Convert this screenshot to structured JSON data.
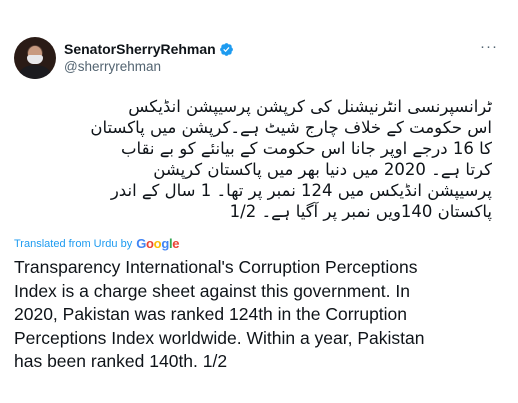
{
  "user": {
    "display_name": "SenatorSherryRehman",
    "handle": "@sherryrehman"
  },
  "icons": {
    "verified": "verified-badge-icon",
    "more": "more-options-icon",
    "avatar": "profile-avatar"
  },
  "colors": {
    "verified": "#1d9bf0",
    "translation_link": "#1d9bf0",
    "secondary_text": "#536471",
    "primary_text": "#0f1419"
  },
  "tweet": {
    "urdu_text": "ٹرانسپرنسی انٹرنیشنل کی کرپشن پرسیپشن انڈیکس\nاس حکومت کے خلاف چارج شیٹ ہے۔کرپشن میں پاکستان\nکا 16 درجے اوپر جانا اس حکومت کے بیانئے کو بے نقاب\nکرتا ہے۔  2020 میں دنیا بھر میں پاکستان کرپشن\nپرسیپشن انڈیکس میں 124 نمبر پر تھا۔ 1 سال کے اندر\nپاکستان 140ویں نمبر پر آگیا ہے۔ 1/2",
    "translated_from": "Translated from Urdu by",
    "translation_provider": "Google",
    "english_text": "Transparency International's Corruption Perceptions\nIndex is a charge sheet against this government. In\n2020, Pakistan was ranked 124th in the Corruption\nPerceptions Index worldwide. Within a year, Pakistan\nhas been ranked 140th. 1/2"
  }
}
